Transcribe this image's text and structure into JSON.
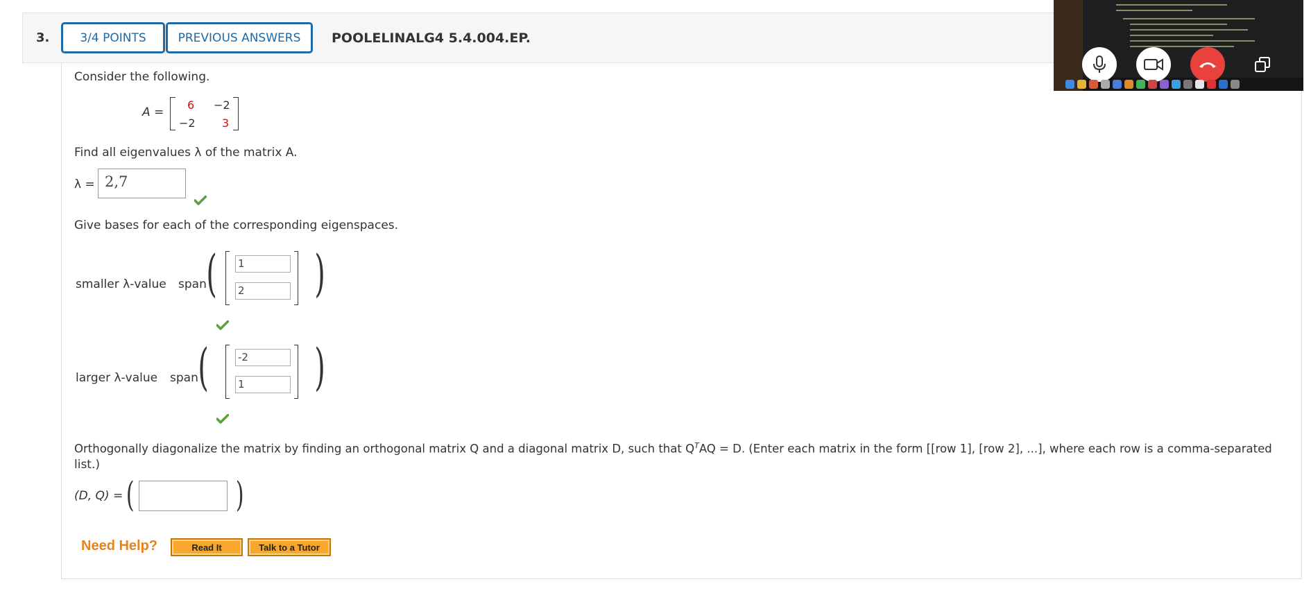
{
  "header": {
    "question_number": "3.",
    "points_label": "3/4 POINTS",
    "previous_answers_label": "PREVIOUS ANSWERS",
    "problem_id": "POOLELINALG4 5.4.004.EP."
  },
  "intro": "Consider the following.",
  "matrix": {
    "label": "A =",
    "a11": "6",
    "a12": "−2",
    "a21": "−2",
    "a22": "3"
  },
  "part1": {
    "prompt": "Find all eigenvalues λ of the matrix A.",
    "lambda_label": "λ =",
    "answer": "2,7"
  },
  "part2": {
    "prompt": "Give bases for each of the corresponding eigenspaces.",
    "smaller_label": "smaller λ-value",
    "larger_label": "larger λ-value",
    "span_label": "span",
    "smaller_vector": [
      "1",
      "2"
    ],
    "larger_vector": [
      "-2",
      "1"
    ]
  },
  "part3": {
    "prompt_start": "Orthogonally diagonalize the matrix by finding an orthogonal matrix Q and a diagonal matrix D, such that Q",
    "prompt_sup": "T",
    "prompt_end": "AQ = D. (Enter each matrix in the form [[row 1], [row 2], ...], where each row is a comma-separated",
    "prompt_line2": "list.)",
    "dq_label": "(D, Q) =",
    "answer": ""
  },
  "help": {
    "label": "Need Help?",
    "read_it": "Read It",
    "talk_to_tutor": "Talk to a Tutor"
  },
  "colors": {
    "accent_blue": "#1e6aa6",
    "correct_green": "#5aa03c",
    "matrix_red": "#d10f0f",
    "help_orange": "#e8831a",
    "end_call_red": "#e9413b"
  },
  "icons": {
    "correct": "check-icon",
    "mic": "microphone-icon",
    "camera": "video-camera-icon",
    "hangup": "end-call-icon",
    "popout": "popout-window-icon"
  }
}
